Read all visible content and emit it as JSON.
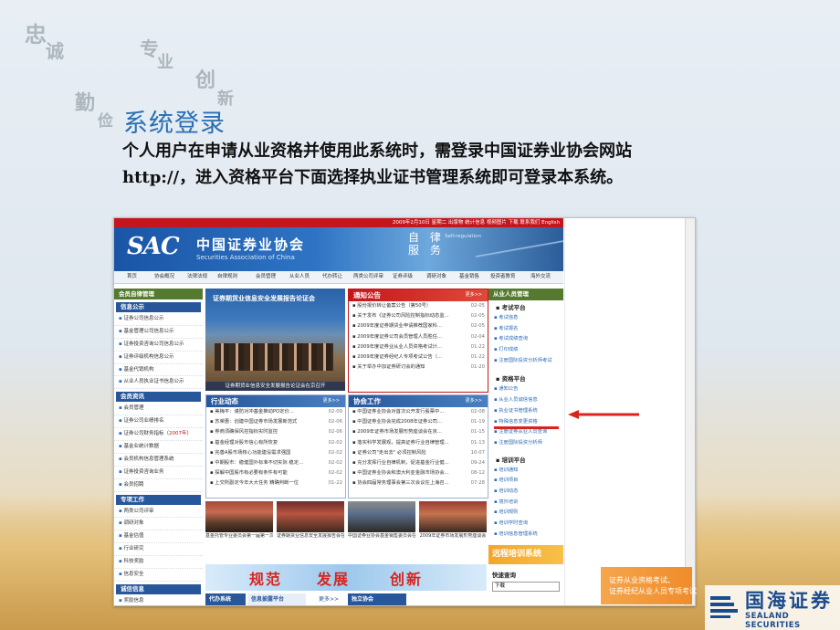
{
  "slide": {
    "title": "系统登录",
    "body_line1": "个人用户在申请从业资格并使用此系统时，需登录中国证券业协会网站",
    "body_line2": "http://，进入资格平台下面选择执业证书管理系统即可登录本系统。",
    "decorative_glyphs": [
      "忠",
      "诚",
      "勤",
      "俭",
      "专",
      "业",
      "创",
      "新"
    ]
  },
  "site": {
    "topbar_text": "2009年2月10日 星期二  出版物  统计信息 视频图片 下载  联系我们 English",
    "logo": "SAC",
    "name_cn": "中国证券业协会",
    "name_en": "Securities Association of China",
    "self_reg_cn": "自 律\n服 务",
    "self_reg_en": "Self-regulation",
    "nav": [
      "首页",
      "协会概况",
      "法律法规",
      "自律规则",
      "会员管理",
      "从业人员",
      "代办转让",
      "两类公司评审",
      "证券评级",
      "调研对象",
      "基金销售",
      "投资者教育",
      "海外交流"
    ]
  },
  "left_col": {
    "header": "会员自律管理",
    "info_header": "信息公示",
    "info_items": [
      "证券公司信息公示",
      "基金管理公司信息公示",
      "证券投资咨询公司信息公示",
      "证券评级机构信息公示",
      "基金代销机构",
      "从业人员执业证书信息公示"
    ],
    "member_header": "会员资讯",
    "member_items": [
      "会员管理",
      "证券公司业绩排名",
      "证券公司财务指标（2007年）",
      "基金业统计数据",
      "会员机构信息管理系统",
      "证券投资咨询业务",
      "会员招聘"
    ],
    "member_highlight": "2007年",
    "special_header": "专项工作",
    "special_items": [
      "两类公司评审",
      "调研对象",
      "基金估值",
      "行业研究",
      "科技奖励",
      "信息安全"
    ],
    "integrity_header": "诚信信息",
    "integrity_items": [
      "奖励信息"
    ]
  },
  "middle_col": {
    "feature_title": "证券期货业信息安全发展报告论证会",
    "feature_caption": "证券期货业信息安全发展报告论证会在京召开",
    "notice_header": "通知公告",
    "more": "更多>>",
    "notices": [
      {
        "t": "股份报价转让备案公告（第50号）",
        "d": "02-05"
      },
      {
        "t": "关于发布《证券公司风险控制指标动态监...",
        "d": "02-05"
      },
      {
        "t": "2009年度证券期货业申请推荐国家科...",
        "d": "02-05"
      },
      {
        "t": "2009年度证券公司会员管理人员胜任...",
        "d": "02-04"
      },
      {
        "t": "2009年度证券业从业人员资格考试计...",
        "d": "01-22"
      },
      {
        "t": "2009年度证券经纪人专项考试公告（...",
        "d": "01-22"
      },
      {
        "t": "关于举办中加证券研讨会的通知",
        "d": "01-20"
      }
    ],
    "industry_header": "行业动态",
    "industry": [
      {
        "t": "美梅平：谨防对冲基金推动PO定价...",
        "d": "02-09"
      },
      {
        "t": "苏荣惠：创建中国证券市场发展新范式",
        "d": "02-06"
      },
      {
        "t": "券商须确保风控指标实时监控",
        "d": "02-06"
      },
      {
        "t": "基金经理对股市信心有所恢复",
        "d": "02-02"
      },
      {
        "t": "完善A股市场核心功能建设需求强国",
        "d": "02-02"
      },
      {
        "t": "中期股市：稳健国外标准不切实际 稳定...",
        "d": "02-02"
      },
      {
        "t": "探解中国股市有必要有条件有可能",
        "d": "02-02"
      },
      {
        "t": "上交所副定今年大大任务 精确判断一位",
        "d": "01-22"
      }
    ],
    "assoc_header": "协会工作",
    "assoc": [
      {
        "t": "中国证券业协会对首次公开发行股票中...",
        "d": "02-08"
      },
      {
        "t": "中国证券业协会完成2008年证券公司...",
        "d": "01-19"
      },
      {
        "t": "2009年证券市场发展形势座谈会在京...",
        "d": "01-15"
      },
      {
        "t": "落实科学发展观，提高证券行业自律管理...",
        "d": "01-13"
      },
      {
        "t": "证券公司\"走出去\" 必须控制风险",
        "d": "10-07"
      },
      {
        "t": "充分发挥行业自律机制，促进基金行业健...",
        "d": "09-24"
      },
      {
        "t": "中国证券业协会和澳大利亚金融市场协会...",
        "d": "08-12"
      },
      {
        "t": "协会四届常务理事会第三次会议在上海召...",
        "d": "07-28"
      }
    ],
    "photo_captions": [
      "基金托管专业委员会第一届第一次会议",
      "证券期货业信息安全发展报告会在京召开",
      "中国证券业协会基金销售委员会在北京召",
      "2009年证券市场发展形势座谈会",
      "证券公司会员第三届"
    ],
    "slogan": [
      "规范",
      "发展",
      "创新"
    ],
    "bottom_tabs": [
      "代办系统",
      "信息披露平台",
      "更多>>",
      "独立协会"
    ]
  },
  "right_col": {
    "header": "从业人员管理",
    "exam_header": "考试平台",
    "exam_items": [
      "考试信息",
      "考试报名",
      "考试成绩查询",
      "打印成绩",
      "注册国际投资分析师考试"
    ],
    "qual_header": "资格平台",
    "qual_items": [
      "通知公告",
      "从业人员诚信信息",
      "执业证书管理系统",
      "特殊信息变更资格",
      "注册证券从业人员查询",
      "注册国际投资分析师"
    ],
    "train_header": "培训平台",
    "train_items": [
      "培训通知",
      "培训项目",
      "培训动态",
      "境外培训",
      "培训规则",
      "培训学时查询",
      "培训信息管理系统"
    ],
    "remote": "远程培训系统",
    "query_header": "快速查询",
    "query_select": "下载"
  },
  "ad": {
    "line1": "证券从业资格考试、",
    "line2": "证券经纪从业人员专项考试"
  },
  "brand": {
    "cn": "国海证券",
    "en": "SEALAND SECURITIES"
  },
  "colors": {
    "title_blue": "#2a6fb3",
    "sac_red": "#c4161c",
    "sac_blue": "#27569b",
    "sac_green": "#557a2f",
    "annotation_red": "#d8241d",
    "brand_blue": "#1a4b8f"
  }
}
